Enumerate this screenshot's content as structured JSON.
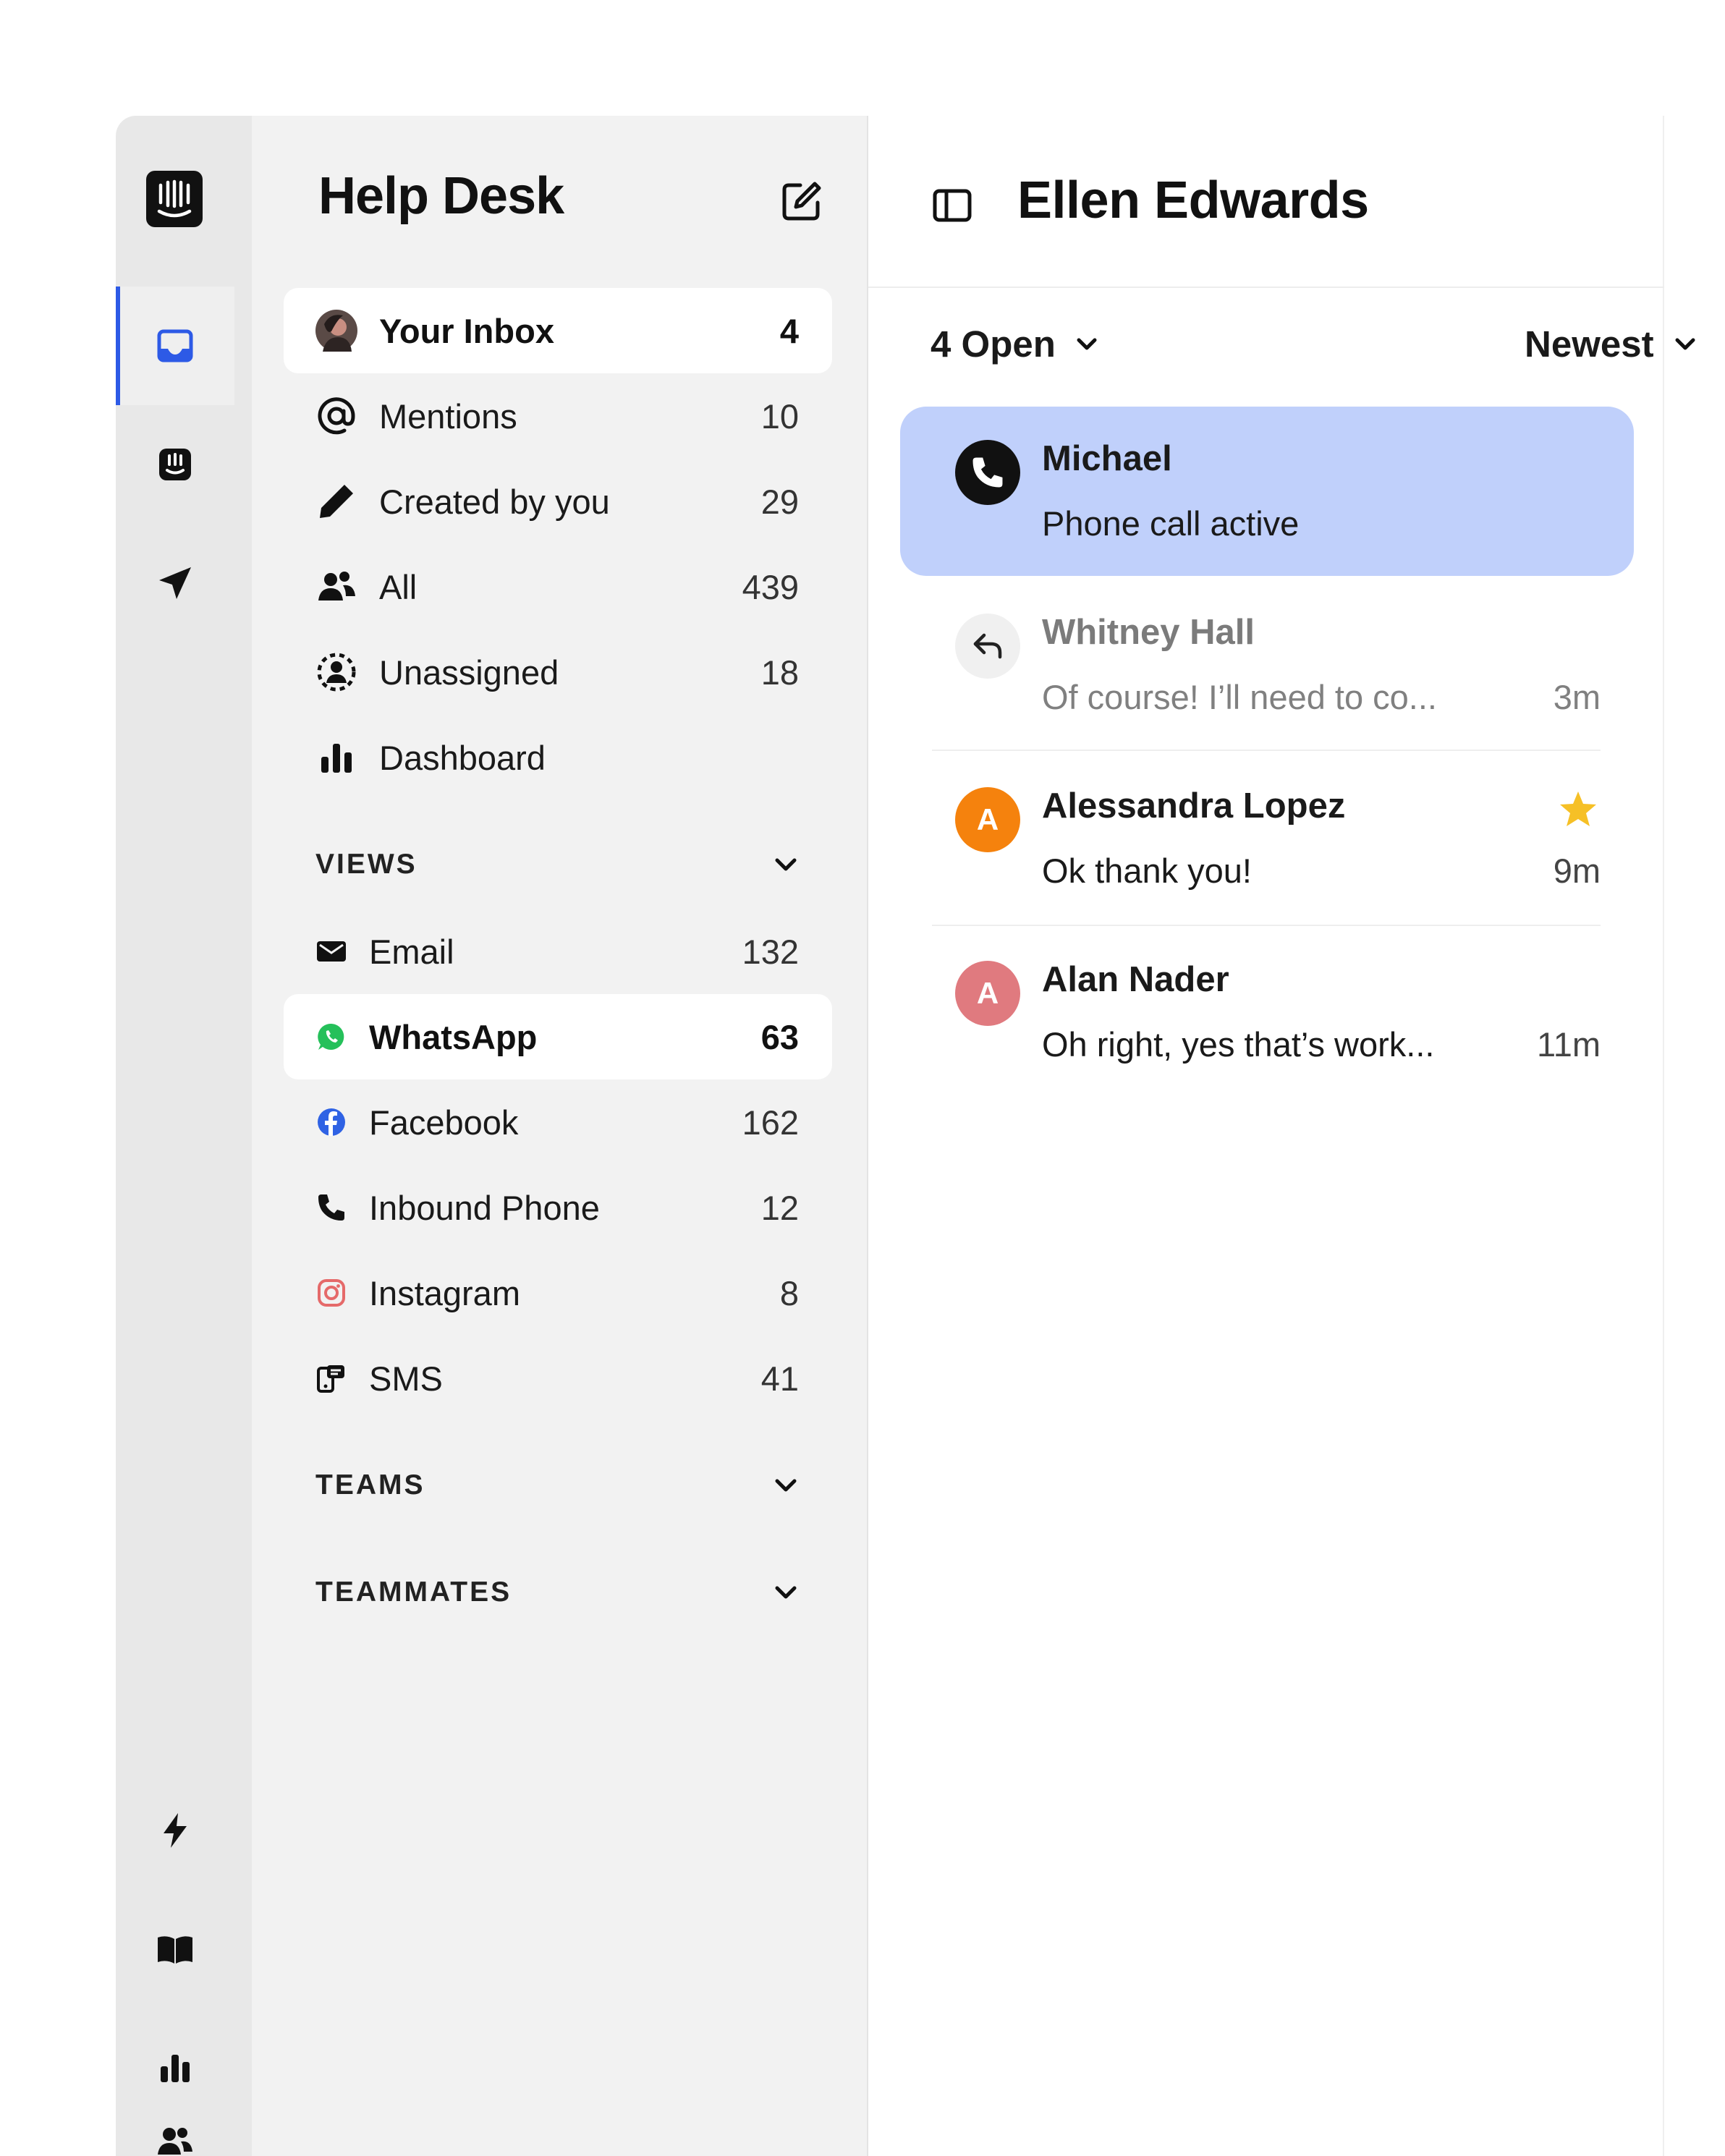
{
  "nav": {
    "title": "Help Desk",
    "items": [
      {
        "label": "Your Inbox",
        "count": "4"
      },
      {
        "label": "Mentions",
        "count": "10"
      },
      {
        "label": "Created by you",
        "count": "29"
      },
      {
        "label": "All",
        "count": "439"
      },
      {
        "label": "Unassigned",
        "count": "18"
      },
      {
        "label": "Dashboard",
        "count": ""
      }
    ],
    "views_label": "VIEWS",
    "views": [
      {
        "label": "Email",
        "count": "132"
      },
      {
        "label": "WhatsApp",
        "count": "63"
      },
      {
        "label": "Facebook",
        "count": "162"
      },
      {
        "label": "Inbound Phone",
        "count": "12"
      },
      {
        "label": "Instagram",
        "count": "8"
      },
      {
        "label": "SMS",
        "count": "41"
      }
    ],
    "teams_label": "TEAMS",
    "teammates_label": "TEAMMATES"
  },
  "list": {
    "contact_name": "Ellen Edwards",
    "status_filter": "4 Open",
    "sort_filter": "Newest",
    "conversations": [
      {
        "name": "Michael",
        "preview": "Phone call active",
        "time": ""
      },
      {
        "name": "Whitney Hall",
        "preview": "Of course! I’ll need to co...",
        "time": "3m"
      },
      {
        "name": "Alessandra Lopez",
        "preview": "Ok thank you!",
        "time": "9m",
        "avatar_letter": "A"
      },
      {
        "name": "Alan Nader",
        "preview": "Oh right, yes that’s work...",
        "time": "11m",
        "avatar_letter": "A"
      }
    ]
  },
  "colors": {
    "accent": "#2d5ae6",
    "active_conversation": "#c0d0fb",
    "avatar_orange": "#f5820d",
    "avatar_pink": "#e07a7f",
    "star": "#f6c026",
    "whatsapp": "#25c05a",
    "facebook": "#2f62e4",
    "instagram": "#e56a6a"
  }
}
